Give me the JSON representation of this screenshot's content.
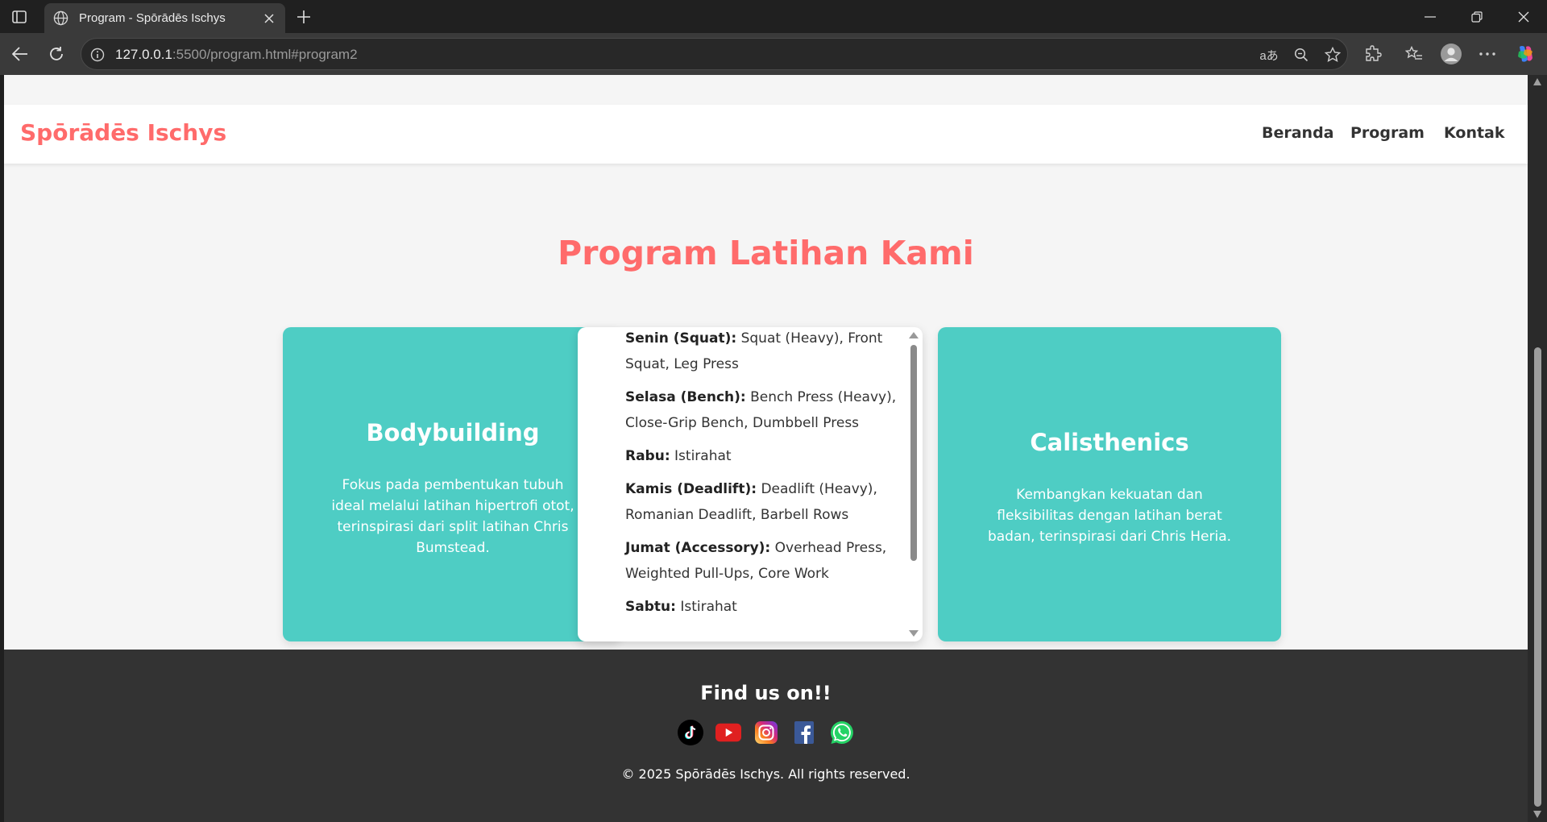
{
  "browser": {
    "tab_title": "Program - Spōrādēs Ischys",
    "url_host": "127.0.0.1",
    "url_rest": ":5500/program.html#program2",
    "read_aloud_label": "aあ"
  },
  "site": {
    "logo": "Spōrādēs Ischys",
    "nav": {
      "home": "Beranda",
      "program": "Program",
      "contact": "Kontak"
    }
  },
  "programs": {
    "title": "Program Latihan Kami",
    "bodybuilding": {
      "title": "Bodybuilding",
      "description": "Fokus pada pembentukan tubuh ideal melalui latihan hipertrofi otot, terinspirasi dari split latihan Chris Bumstead."
    },
    "calisthenics": {
      "title": "Calisthenics",
      "description": "Kembangkan kekuatan dan fleksibilitas dengan latihan berat badan, terinspirasi dari Chris Heria."
    },
    "schedule": [
      {
        "day": "Senin (Squat):",
        "detail": "Squat (Heavy), Front Squat, Leg Press"
      },
      {
        "day": "Selasa (Bench):",
        "detail": "Bench Press (Heavy), Close-Grip Bench, Dumbbell Press"
      },
      {
        "day": "Rabu:",
        "detail": "Istirahat"
      },
      {
        "day": "Kamis (Deadlift):",
        "detail": "Deadlift (Heavy), Romanian Deadlift, Barbell Rows"
      },
      {
        "day": "Jumat (Accessory):",
        "detail": "Overhead Press, Weighted Pull-Ups, Core Work"
      },
      {
        "day": "Sabtu:",
        "detail": "Istirahat"
      }
    ]
  },
  "footer": {
    "title": "Find us on!!",
    "copyright": "© 2025 Spōrādēs Ischys. All rights reserved.",
    "socials": [
      "tiktok-icon",
      "youtube-icon",
      "instagram-icon",
      "facebook-icon",
      "whatsapp-icon"
    ]
  },
  "colors": {
    "accent": "#ff6b6b",
    "card": "#4ecdc4",
    "footer": "#333333"
  }
}
